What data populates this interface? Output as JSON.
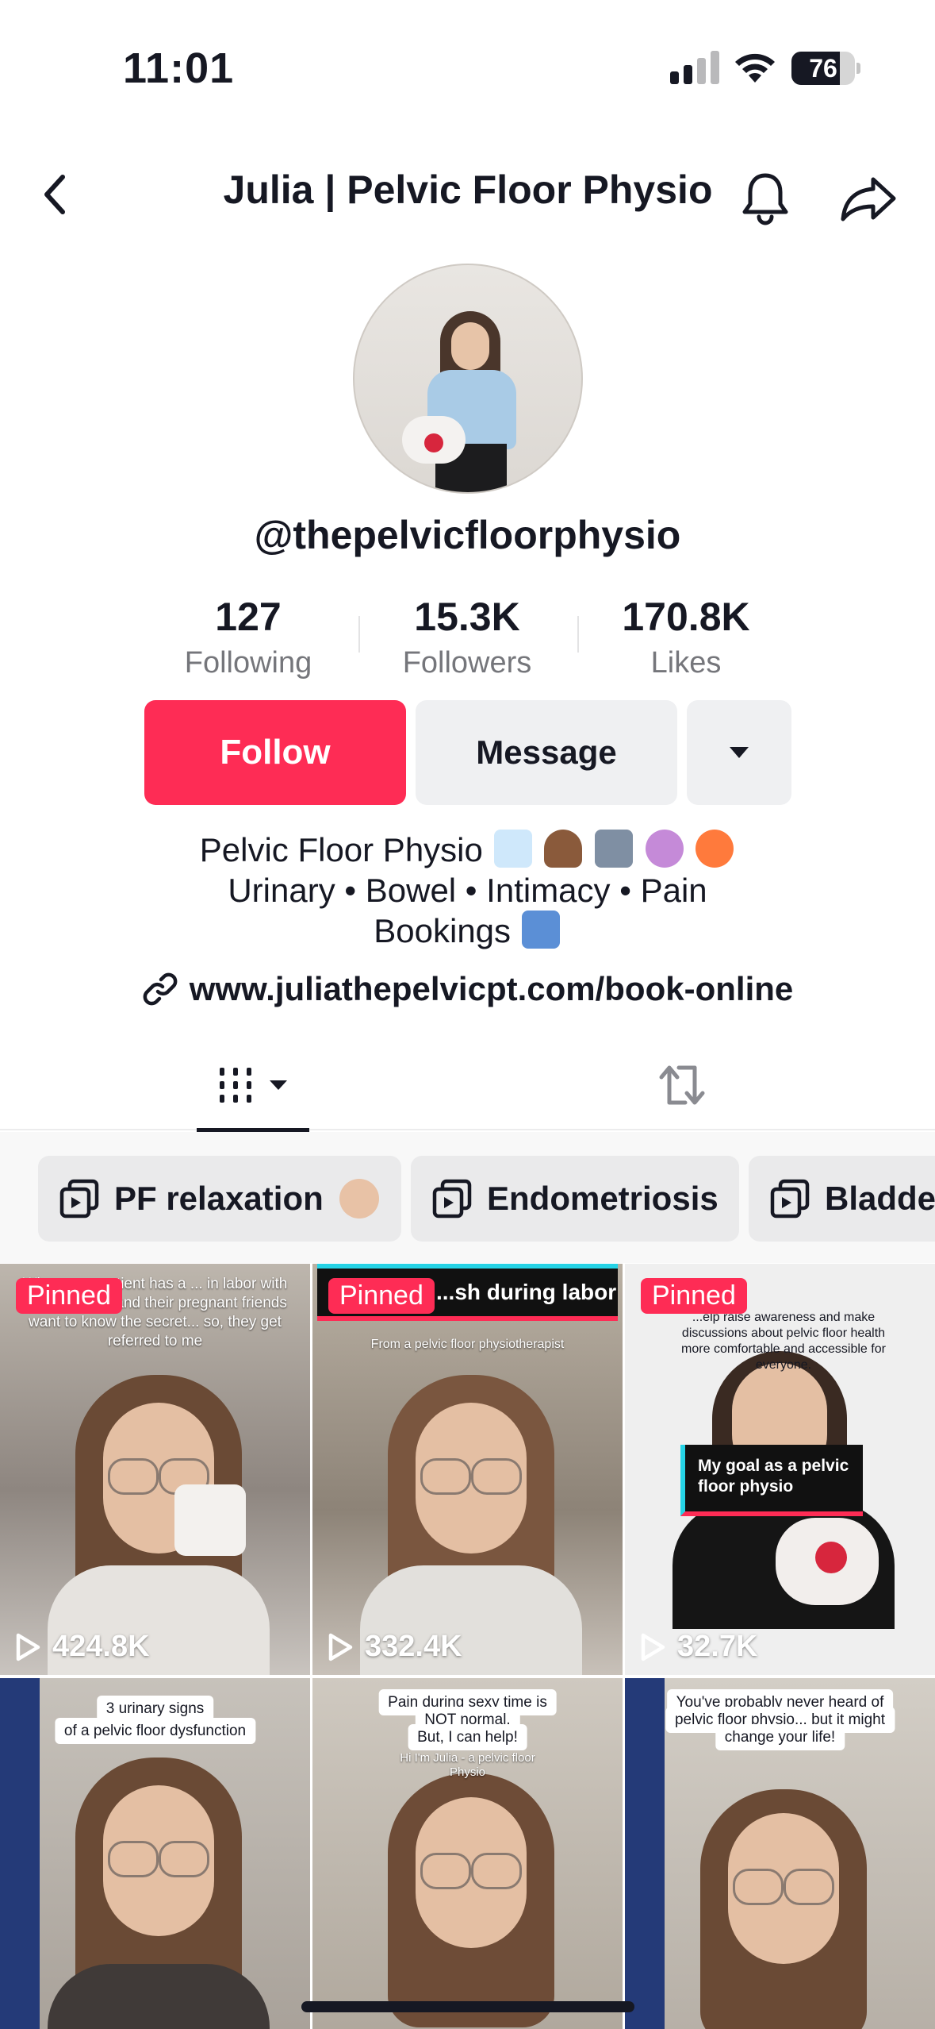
{
  "status_bar": {
    "time": "11:01",
    "battery": "76",
    "battery_level": 0.76
  },
  "header": {
    "title": "Julia | Pelvic Floor Physio"
  },
  "profile": {
    "username": "@thepelvicfloorphysio",
    "stats": [
      {
        "value": "127",
        "label": "Following"
      },
      {
        "value": "15.3K",
        "label": "Followers"
      },
      {
        "value": "170.8K",
        "label": "Likes"
      }
    ],
    "follow_label": "Follow",
    "message_label": "Message",
    "bio": {
      "line1": "Pelvic Floor Physio",
      "line2": "Urinary • Bowel • Intimacy • Pain",
      "line3": "Bookings"
    },
    "link": "www.juliathepelvicpt.com/book-online"
  },
  "playlists": [
    {
      "label": "PF relaxation"
    },
    {
      "label": "Endometriosis"
    },
    {
      "label": "Bladde"
    }
  ],
  "videos": [
    {
      "pinned": "Pinned",
      "views": "424.8K",
      "caption": "When your patient has a ... in labor with no ... tearing, and their pregnant friends want to know the secret... so, they get referred to me"
    },
    {
      "pinned": "Pinned",
      "views": "332.4K",
      "caption": "...sh during labor",
      "subcaption": "From a pelvic floor physiotherapist"
    },
    {
      "pinned": "Pinned",
      "views": "32.7K",
      "caption": "...elp raise awareness and make discussions about pelvic floor health more comfortable and accessible for everyone.",
      "banner": "My goal as a pelvic floor physio"
    },
    {
      "caption": "3 urinary signs",
      "caption2": "of a pelvic floor dysfunction"
    },
    {
      "caption": "Pain during sexy time is",
      "caption2": "NOT normal.",
      "caption3": "But, I can help!",
      "subcaption": "Hi I'm Julia - a pelvic floor",
      "subcaption2": "Physio"
    },
    {
      "caption": "You've probably never heard of",
      "caption2": "pelvic floor physio... but it might",
      "caption3": "change your life!"
    }
  ],
  "colors": {
    "accent": "#fe2c55",
    "secondary_button": "#eff0f2",
    "text": "#161823",
    "muted": "#75767b"
  }
}
